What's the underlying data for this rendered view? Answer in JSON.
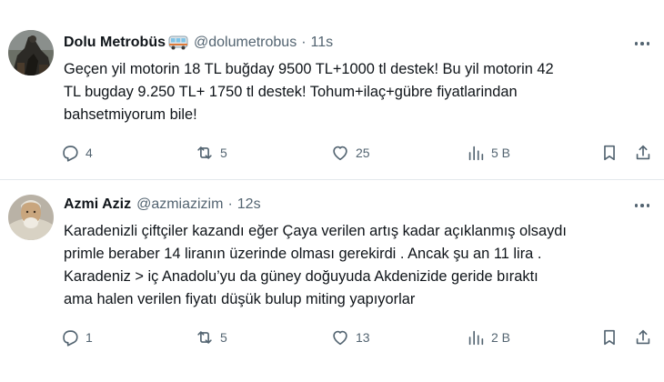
{
  "tweets": [
    {
      "author": "Dolu Metrobüs",
      "badge_icon": "bus-emoji-icon",
      "handle": "@dolumetrobus",
      "separator": "·",
      "time": "11s",
      "lines": [
        "Geçen yil motorin 18 TL buğday 9500 TL+1000 tl destek! Bu yil motorin 42",
        "TL bugday 9.250 TL+ 1750 tl destek! Tohum+ilaç+gübre fiyatlarindan",
        "bahsetmiyorum bile!"
      ],
      "replies": "4",
      "retweets": "5",
      "likes": "25",
      "views": "5 B"
    },
    {
      "author": "Azmi Aziz",
      "handle": "@azmiazizim",
      "separator": "·",
      "time": "12s",
      "lines": [
        "Karadenizli çiftçiler kazandı eğer Çaya verilen artış kadar açıklanmış olsaydı",
        "primle beraber 14 liranın üzerinde olması gerekirdi . Ancak şu an 11 lira .",
        "Karadeniz > iç Anadolu’yu da güney doğuyuda Akdenizide geride bıraktı",
        "ama halen verilen fiyatı düşük bulup miting yapıyorlar"
      ],
      "replies": "1",
      "retweets": "5",
      "likes": "13",
      "views": "2 B"
    }
  ],
  "colors": {
    "text_primary": "#0f1419",
    "text_secondary": "#536471",
    "divider": "#e4e8ec",
    "background": "#ffffff"
  }
}
